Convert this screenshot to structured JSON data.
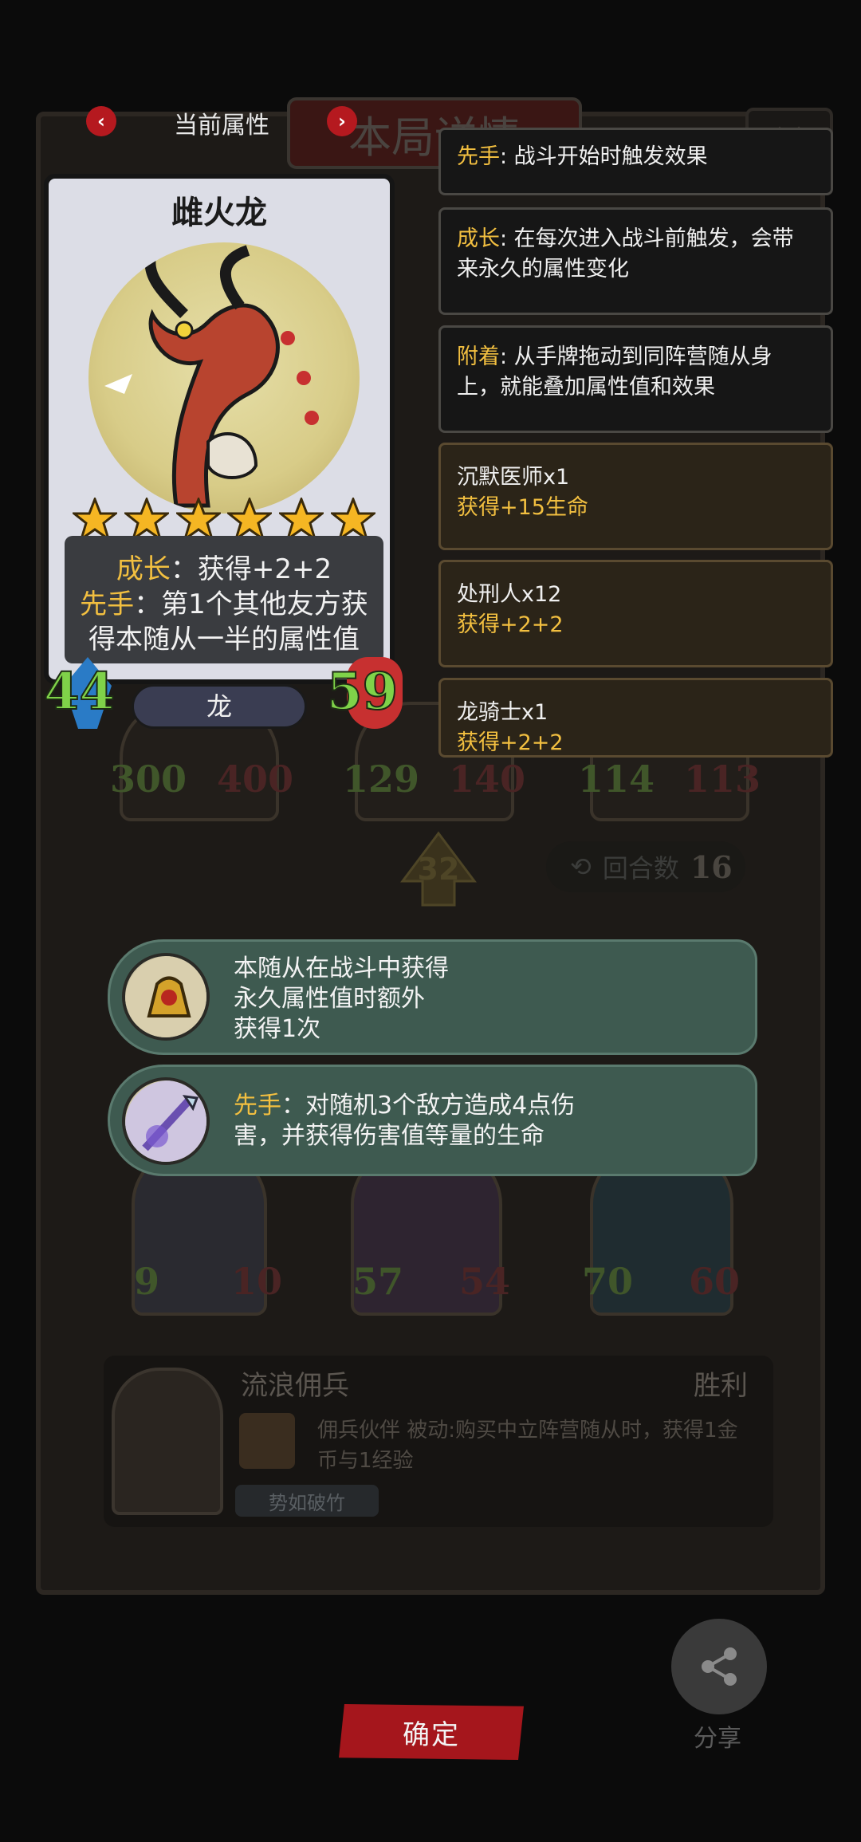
{
  "nav": {
    "title": "当前属性",
    "prev_arrow": "‹",
    "next_arrow": "›"
  },
  "background": {
    "header_tab": "本局详情",
    "close_icon": "close-icon",
    "top_row_stats": [
      {
        "atk": "300",
        "hp": "400"
      },
      {
        "atk": "129",
        "hp": "140"
      },
      {
        "atk": "114",
        "hp": "113"
      }
    ],
    "bottom_row_stats": [
      {
        "atk": "9",
        "hp": "10"
      },
      {
        "atk": "57",
        "hp": "54"
      },
      {
        "atk": "70",
        "hp": "60"
      }
    ],
    "turn_level": "32",
    "round_label": "回合数",
    "round_value": "16",
    "mercenary": {
      "name": "流浪佣兵",
      "result": "胜利",
      "description": "佣兵伙伴 被动:购买中立阵营随从时，获得1金币与1经验",
      "tag": "势如破竹"
    }
  },
  "card": {
    "name": "雌火龙",
    "stars": 6,
    "growth_keyword": "成长",
    "growth_text": "：获得+2+2",
    "opener_keyword": "先手",
    "opener_text_line1": "：第1个其他友方获",
    "opener_text_line2": "得本随从一半的属性值",
    "attack": "44",
    "health": "59",
    "tribe": "龙"
  },
  "keyword_panels": [
    {
      "keyword": "先手",
      "text": ": 战斗开始时触发效果"
    },
    {
      "keyword": "成长",
      "text": ": 在每次进入战斗前触发，会带来永久的属性变化"
    },
    {
      "keyword": "附着",
      "text": ": 从手牌拖动到同阵营随从身上，就能叠加属性值和效果"
    }
  ],
  "buff_panels": [
    {
      "source": "沉默医师x1",
      "gain": "获得+15生命"
    },
    {
      "source": "处刑人x12",
      "gain": "获得+2+2"
    },
    {
      "source": "龙骑士x1",
      "gain": "获得+2+2"
    }
  ],
  "tooltips": [
    {
      "icon": "golden-bell-icon",
      "lines": [
        "本随从在战斗中获得",
        "永久属性值时额外",
        "获得1次"
      ]
    },
    {
      "icon": "spear-relic-icon",
      "keyword": "先手",
      "line1": "：对随机3个敌方造成4点伤",
      "line2": "害，并获得伤害值等量的生命"
    }
  ],
  "footer": {
    "confirm_label": "确定",
    "share_label": "分享"
  },
  "colors": {
    "keyword": "#f2bf40",
    "confirm": "#a5161c",
    "tooltip_bg": "#3e5a50",
    "stat_green": "#7fd249"
  }
}
